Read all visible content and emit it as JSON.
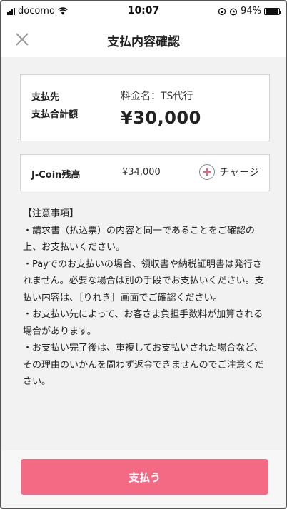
{
  "status_bar": {
    "carrier": "docomo",
    "time": "10:07",
    "battery": "94%",
    "battery_level": 0.94
  },
  "header": {
    "title": "支払内容確認",
    "close_icon": "close-icon"
  },
  "payment": {
    "payee_label": "支払先",
    "total_label": "支払合計額",
    "fee_name": "料金名：TS代行",
    "amount": "¥30,000"
  },
  "coin": {
    "label": "J-Coin残高",
    "balance": "¥34,000",
    "charge_label": "チャージ",
    "charge_icon": "plus-circle-icon"
  },
  "notes": [
    "【注意事項】",
    "・請求書（払込票）の内容と同一であることをご確認の上、お支払いください。",
    "・Payでのお支払いの場合、領収書や納税証明書は発行されません。必要な場合は別の手段でお支払いください。支払い内容は、［りれき］画面でご確認ください。",
    "・お支払い先によって、お客さま負担手数料が加算される場合があります。",
    "・お支払い完了後は、重複してお支払いされた場合など、その理由のいかんを問わず返金できませんのでご注意ください。"
  ],
  "footer": {
    "pay_button_label": "支払う"
  },
  "colors": {
    "accent": "#f46a84",
    "background": "#f2f2f2"
  }
}
